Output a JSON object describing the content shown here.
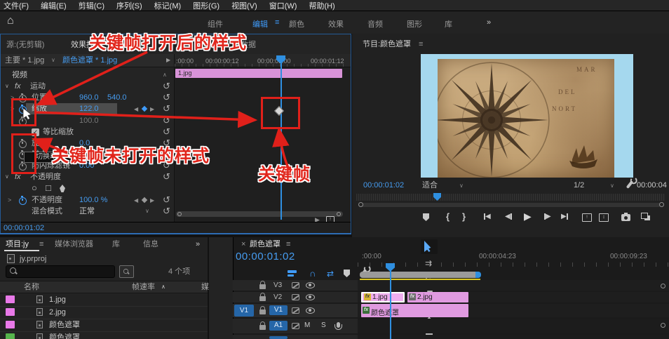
{
  "menu": {
    "items": [
      "文件(F)",
      "编辑(E)",
      "剪辑(C)",
      "序列(S)",
      "标记(M)",
      "图形(G)",
      "视图(V)",
      "窗口(W)",
      "帮助(H)"
    ]
  },
  "workspace": {
    "tabs": [
      "组件",
      "编辑",
      "颜色",
      "效果",
      "音频",
      "图形",
      "库"
    ],
    "active": "编辑",
    "overflow": "»"
  },
  "annotations": {
    "keyframe_on": "关键帧打开后的样式",
    "keyframe_off": "关键帧未打开的样式",
    "keyframe": "关键帧"
  },
  "effect_controls": {
    "tab_source": "源:(无剪辑)",
    "tab_effects": "效果控件",
    "tab_metadata": "元数据",
    "master": "主要 * 1.jpg",
    "linked": "颜色遮罩 * 1.jpg",
    "section_video": "视频",
    "fx_motion": "运动",
    "position_label": "位置",
    "position_x": "960.0",
    "position_y": "540.0",
    "scale_label": "缩放",
    "scale_value": "122.0",
    "scale_width_value": "100.0",
    "uniform_label": "等比缩放",
    "rotation_label": "旋转",
    "rotation_value": "0.0",
    "anchor_label": "锚点",
    "flicker_label": "防闪烁滤镜",
    "flicker_value": "0.00",
    "fx_opacity": "不透明度",
    "opacity_label": "不透明度",
    "opacity_value": "100.0 %",
    "blend_label": "混合模式",
    "blend_value": "正常",
    "tooltip": "切换动画",
    "ruler": [
      ":00:00",
      "00:00:00:12",
      "00:00:01:00",
      "00:00:01:12"
    ],
    "clip_name": "1.jpg",
    "timecode": "00:00:01:02"
  },
  "program": {
    "tab": "节目:颜色遮罩",
    "timecode": "00:00:01:02",
    "fit": "适合",
    "quality": "1/2",
    "duration": "00:00:04",
    "map": {
      "t1": "MAR",
      "t2": "DEL",
      "t3": "NORT"
    }
  },
  "project": {
    "tab_project": "项目:jy",
    "tab_media": "媒体浏览器",
    "tab_libraries": "库",
    "tab_info": "信息",
    "file": "jy.prproj",
    "count": "4 个项",
    "col_name": "名称",
    "col_rate": "帧速率",
    "col_media": "媒",
    "rows": [
      {
        "name": "1.jpg"
      },
      {
        "name": "2.jpg"
      },
      {
        "name": "颜色遮罩"
      },
      {
        "name": "颜色遮罩"
      }
    ]
  },
  "timeline": {
    "tab": "颜色遮罩",
    "timecode": "00:00:01:02",
    "ruler": [
      ":00:00",
      "00:00:04:23",
      "00:00:09:23"
    ],
    "v3": "V3",
    "v2": "V2",
    "v1": "V1",
    "a1": "A1",
    "patch_v1": "V1",
    "mute": "M",
    "solo": "S",
    "clip1": "1.jpg",
    "clip2": "2.jpg",
    "clip_matte": "颜色遮罩"
  },
  "icons": {
    "burger": "≡",
    "home": "⌂",
    "chevron_down": "∨",
    "chevron_up": "∧",
    "chevron_right": "▶",
    "expand": ">",
    "overflow": "»",
    "reset": "↺",
    "snap": "∩",
    "close": "×",
    "mark_in": "{",
    "mark_out": "}",
    "play": "▶",
    "left": "◀",
    "right": "▶",
    "circle": "○",
    "square": "□",
    "check": "✓",
    "fx": "fx",
    "link": "⇄",
    "track_select": "⇉",
    "ripple": "⇆",
    "slip": "↔",
    "up": "↑",
    "updown": "↕"
  }
}
